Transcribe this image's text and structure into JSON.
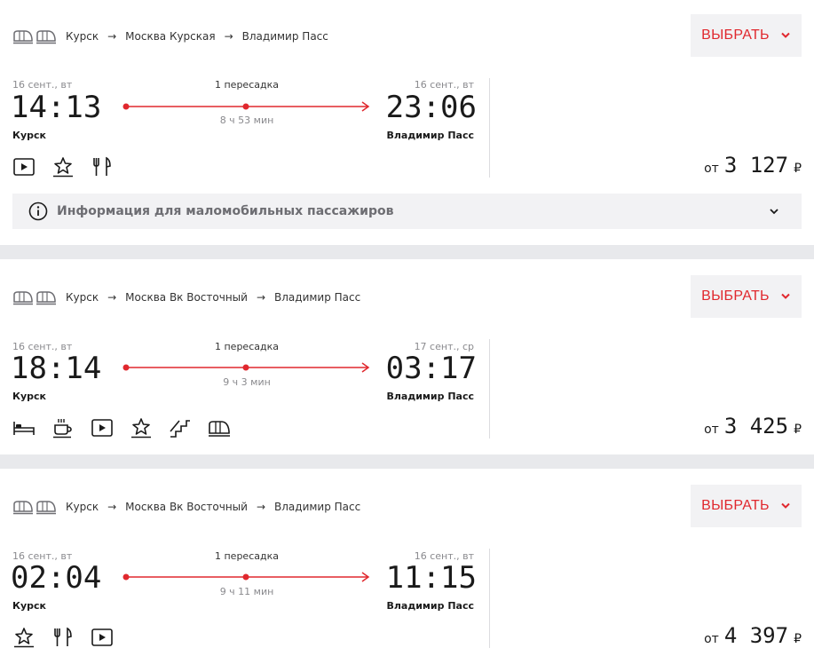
{
  "select_label": "ВЫБРАТЬ",
  "price_from": "от",
  "currency": "₽",
  "accent_color": "#e0282e",
  "info_banner": {
    "text": "Информация для маломобильных пассажиров",
    "icon": "info-circle-icon"
  },
  "trips": [
    {
      "route": [
        "Курск",
        "Москва Курская",
        "Владимир Пасс"
      ],
      "dep_date": "16 сент., вт",
      "dep_time": "14:13",
      "dep_city": "Курск",
      "arr_date": "16 сент., вт",
      "arr_time": "23:06",
      "arr_city": "Владимир Пасс",
      "transfers": "1 пересадка",
      "duration": "8 ч 53 мин",
      "price": "3 127",
      "amenities": [
        "video-icon",
        "star-icon",
        "dining-icon"
      ]
    },
    {
      "route": [
        "Курск",
        "Москва Вк Восточный",
        "Владимир Пасс"
      ],
      "dep_date": "16 сент., вт",
      "dep_time": "18:14",
      "dep_city": "Курск",
      "arr_date": "17 сент., ср",
      "arr_time": "03:17",
      "arr_city": "Владимир Пасс",
      "transfers": "1 пересадка",
      "duration": "9 ч 3 мин",
      "price": "3 425",
      "amenities": [
        "bed-icon",
        "coffee-icon",
        "video-icon",
        "star-icon",
        "stairs-icon",
        "train-icon"
      ]
    },
    {
      "route": [
        "Курск",
        "Москва Вк Восточный",
        "Владимир Пасс"
      ],
      "dep_date": "16 сент., вт",
      "dep_time": "02:04",
      "dep_city": "Курск",
      "arr_date": "16 сент., вт",
      "arr_time": "11:15",
      "arr_city": "Владимир Пасс",
      "transfers": "1 пересадка",
      "duration": "9 ч 11 мин",
      "price": "4 397",
      "amenities": [
        "star-icon",
        "dining-icon",
        "video-icon"
      ]
    }
  ]
}
